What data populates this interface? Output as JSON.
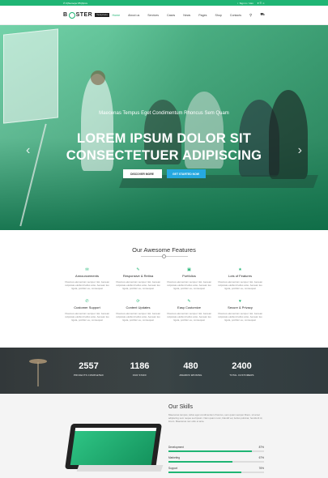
{
  "topbar": {
    "contact": "✆ 0(Name)er 85(0)ccs",
    "signin": "♀ Sign in / Join",
    "cart": "♥ ☰ ☺"
  },
  "brand": {
    "logo_left": "B",
    "logo_right": "STER",
    "tag": "Template"
  },
  "nav": {
    "items": [
      "Home",
      "About us",
      "Services",
      "Cases",
      "News",
      "Pages",
      "Shop",
      "Contacts"
    ],
    "active": "Home",
    "search_icon": "🔍",
    "cart_icon": "🛒"
  },
  "hero": {
    "subtitle": "Maecenas Tempus Eget Condimentum Rhoncus Sem Quam",
    "title_line1": "LOREM IPSUM DOLOR SIT",
    "title_line2": "CONSECTETUER ADIPISCING",
    "btn_primary": "DISCOVER MORE",
    "btn_secondary": "GET STARTED NOW",
    "prev": "‹",
    "next": "›",
    "accent": "#1fb574",
    "button_blue": "#26a9e0"
  },
  "features": {
    "title": "Our Awesome Features",
    "items": [
      {
        "icon": "✉",
        "icon_name": "megaphone-icon",
        "title": "Announcements",
        "desc": "Vivamus elementum semper nisi. Aenean vulputate eleifend tellus ante. Aenean leo ligula, porttitor eu, consequat"
      },
      {
        "icon": "✎",
        "icon_name": "pencil-icon",
        "title": "Responsive & Retina",
        "desc": "Vivamus elementum semper nisi. Aenean vulputate eleifend tellus ante. Aenean leo ligula, porttitor eu, consequat"
      },
      {
        "icon": "▣",
        "icon_name": "briefcase-icon",
        "title": "Portfolios",
        "desc": "Vivamus elementum semper nisi. Aenean vulputate eleifend tellus ante. Aenean leo ligula, porttitor eu, consequat"
      },
      {
        "icon": "★",
        "icon_name": "star-icon",
        "title": "Lots of Features",
        "desc": "Vivamus elementum semper nisi. Aenean vulputate eleifend tellus ante. Aenean leo ligula, porttitor eu, consequat"
      },
      {
        "icon": "✆",
        "icon_name": "phone-icon",
        "title": "Customer Support",
        "desc": "Vivamus elementum semper nisi. Aenean vulputate eleifend tellus ante. Aenean leo ligula, porttitor eu, consequat"
      },
      {
        "icon": "⟳",
        "icon_name": "refresh-icon",
        "title": "Content Updates",
        "desc": "Vivamus elementum semper nisi. Aenean vulputate eleifend tellus ante. Aenean leo ligula, porttitor eu, consequat"
      },
      {
        "icon": "✎",
        "icon_name": "edit-icon",
        "title": "Easy Customize",
        "desc": "Vivamus elementum semper nisi. Aenean vulputate eleifend tellus ante. Aenean leo ligula, porttitor eu, consequat"
      },
      {
        "icon": "♥",
        "icon_name": "heart-icon",
        "title": "Secure & Privacy",
        "desc": "Vivamus elementum semper nisi. Aenean vulputate eleifend tellus ante. Aenean leo ligula, porttitor eu, consequat"
      }
    ]
  },
  "stats": [
    {
      "num": "2557",
      "label": "PROJECTS COMPLETED"
    },
    {
      "num": "1186",
      "label": "OUR STAFF"
    },
    {
      "num": "480",
      "label": "AWARDS WINNING"
    },
    {
      "num": "2400",
      "label": "TOTAL CUSTOMERS"
    }
  ],
  "skills": {
    "title": "Our Skills",
    "desc": "Maecenas tempus, tellus eget condimentum rhoncus, sem quam semper libero, sit amet adipiscing sem neque sed ipsum. Nam quam nunc, blandit vel, luctus pulvinar, hendrerit id, lorem. Maecenas nec odio et ante.",
    "items": [
      {
        "label": "Development",
        "value": "87%",
        "pct": 87
      },
      {
        "label": "Marketing",
        "value": "67%",
        "pct": 67
      },
      {
        "label": "Support",
        "value": "76%",
        "pct": 76
      }
    ]
  }
}
